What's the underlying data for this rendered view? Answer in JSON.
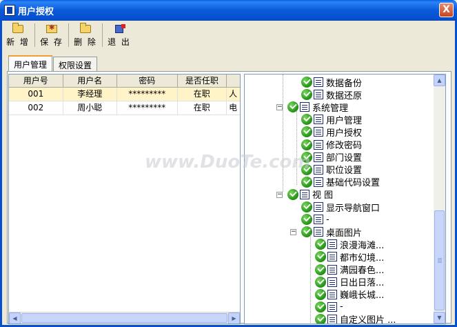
{
  "window": {
    "title": "用户授权",
    "close_glyph": "X"
  },
  "toolbar": {
    "buttons": [
      {
        "label": "新 增",
        "icon": "folder-icon"
      },
      {
        "label": "保 存",
        "icon": "save-icon"
      },
      {
        "label": "删 除",
        "icon": "folder-icon"
      },
      {
        "label": "退 出",
        "icon": "exit-icon"
      }
    ]
  },
  "tabs": [
    {
      "label": "用户管理",
      "active": true
    },
    {
      "label": "权限设置",
      "active": false
    }
  ],
  "grid": {
    "headers": [
      "用户号",
      "用户名",
      "密码",
      "是否任职",
      ""
    ],
    "rows": [
      {
        "id": "001",
        "name": "李经理",
        "password": "*********",
        "status": "在职",
        "extra": "人"
      },
      {
        "id": "002",
        "name": "周小聪",
        "password": "*********",
        "status": "在职",
        "extra": "电"
      }
    ]
  },
  "tree": {
    "nodes": [
      {
        "label": "数据备份",
        "level": 2,
        "checked": true
      },
      {
        "label": "数据还原",
        "level": 2,
        "checked": true
      },
      {
        "label": "系统管理",
        "level": 1,
        "checked": true,
        "expander": "−"
      },
      {
        "label": "用户管理",
        "level": 2,
        "checked": true
      },
      {
        "label": "用户授权",
        "level": 2,
        "checked": true
      },
      {
        "label": "修改密码",
        "level": 2,
        "checked": true
      },
      {
        "label": "部门设置",
        "level": 2,
        "checked": true
      },
      {
        "label": "职位设置",
        "level": 2,
        "checked": true
      },
      {
        "label": "基础代码设置",
        "level": 2,
        "checked": true
      },
      {
        "label": "视 图",
        "level": 1,
        "checked": true,
        "expander": "−"
      },
      {
        "label": "显示导航窗口",
        "level": 2,
        "checked": true
      },
      {
        "label": "-",
        "level": 2,
        "checked": true
      },
      {
        "label": "桌面图片",
        "level": 2,
        "checked": true,
        "expander": "−"
      },
      {
        "label": "浪漫海滩...",
        "level": 3,
        "checked": true
      },
      {
        "label": "都市幻境...",
        "level": 3,
        "checked": true
      },
      {
        "label": "满园春色...",
        "level": 3,
        "checked": true
      },
      {
        "label": "日出日落...",
        "level": 3,
        "checked": true
      },
      {
        "label": "巍峨长城...",
        "level": 3,
        "checked": true
      },
      {
        "label": "-",
        "level": 3,
        "checked": true
      },
      {
        "label": "自定义图片 ...",
        "level": 3,
        "checked": true
      }
    ]
  },
  "watermark": "www.DuoTe.com"
}
